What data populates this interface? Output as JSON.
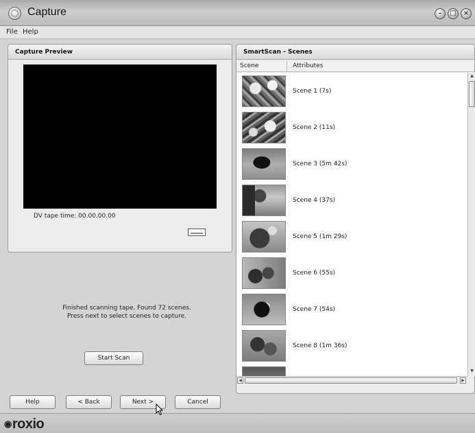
{
  "window": {
    "title": "Capture"
  },
  "menu": {
    "file": "File",
    "help": "Help"
  },
  "preview": {
    "header": "Capture Preview",
    "tape_time": "DV tape time: 00.00.00.00"
  },
  "scan": {
    "status_line1": "Finished scanning tape. Found 72 scenes.",
    "status_line2": "Press next to select scenes to capture.",
    "start_label": "Start Scan"
  },
  "scenes": {
    "header": "SmartScan - Scenes",
    "col_scene": "Scene",
    "col_attributes": "Attributes",
    "items": [
      {
        "label": "Scene 1 (7s)"
      },
      {
        "label": "Scene 2 (11s)"
      },
      {
        "label": "Scene 3 (5m 42s)"
      },
      {
        "label": "Scene 4 (37s)"
      },
      {
        "label": "Scene 5 (1m 29s)"
      },
      {
        "label": "Scene 6 (55s)"
      },
      {
        "label": "Scene 7 (54s)"
      },
      {
        "label": "Scene 8 (1m 36s)"
      }
    ]
  },
  "footer": {
    "help": "Help",
    "back": "< Back",
    "next": "Next >",
    "cancel": "Cancel",
    "brand": "roxio"
  }
}
